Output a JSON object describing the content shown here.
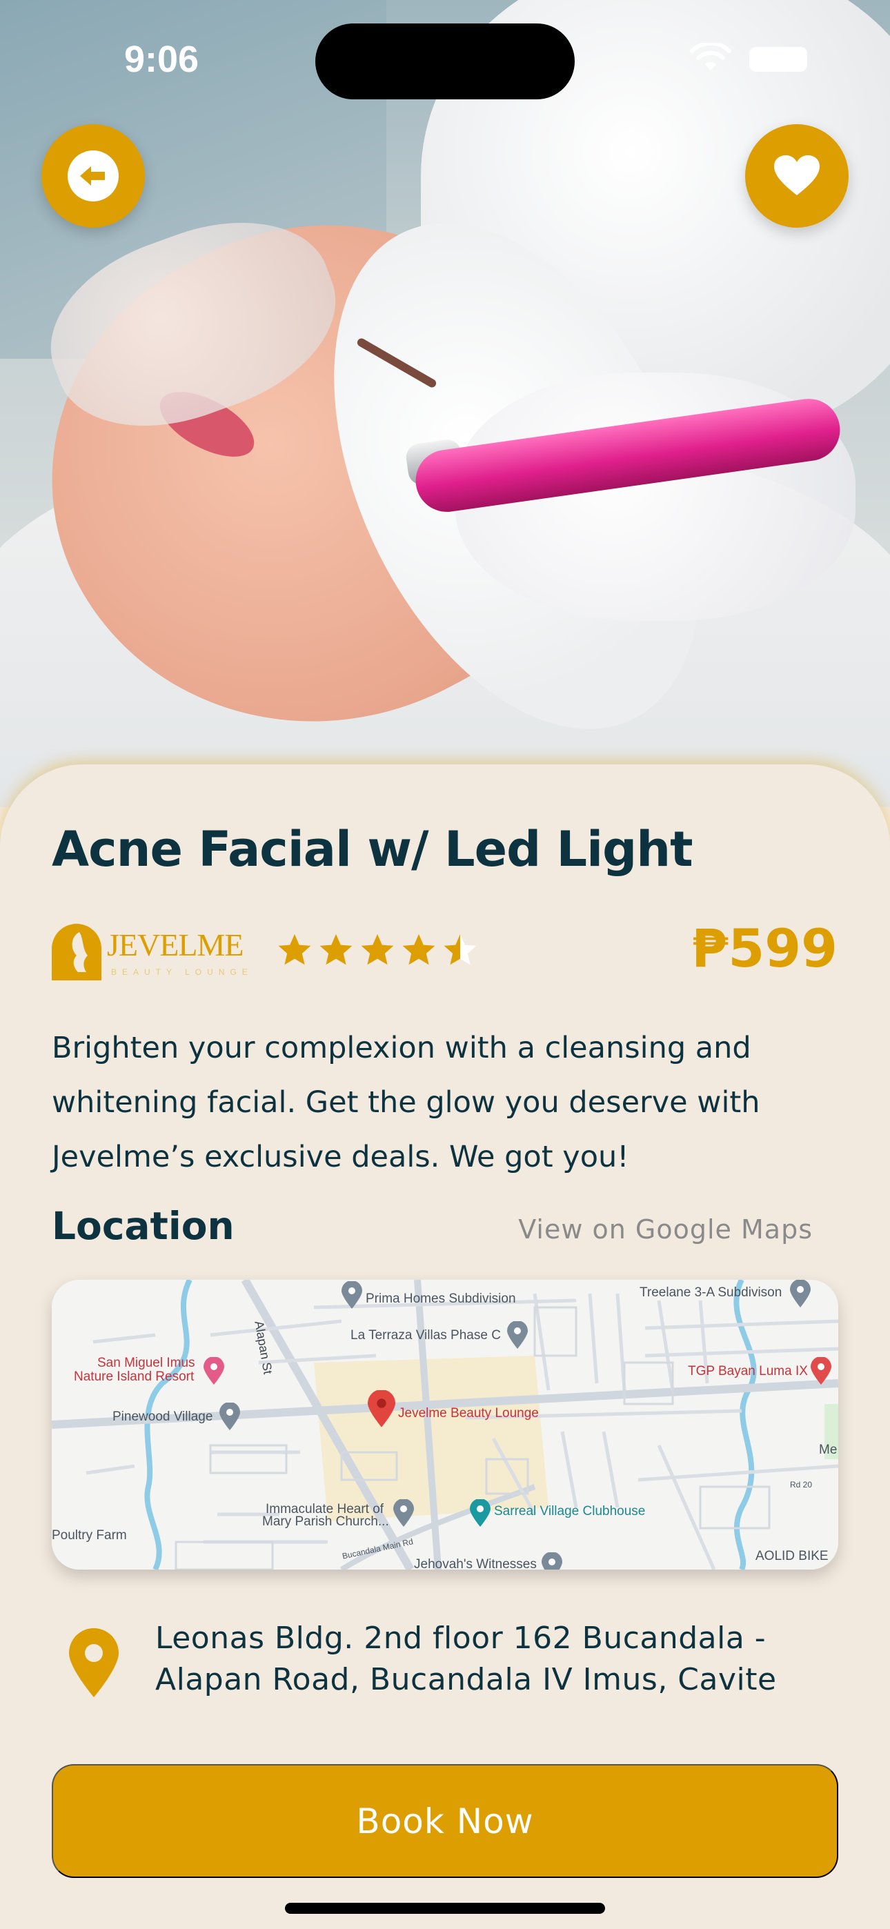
{
  "status_bar": {
    "time": "9:06"
  },
  "service": {
    "title": "Acne Facial w/ Led Light",
    "price": "₱599",
    "rating": 4.5,
    "rating_max": 5,
    "description": "Brighten your complexion with a cleansing and whitening facial. Get the glow you deserve with Jevelme’s exclusive deals. We got you!"
  },
  "brand": {
    "logo_text": "JEVELME",
    "logo_subtext": "BEAUTY LOUNGE"
  },
  "location": {
    "heading": "Location",
    "maps_link": "View on Google Maps",
    "address": "Leonas Bldg. 2nd floor 162 Bucandala - Alapan Road, Bucandala IV Imus, Cavite",
    "map_labels": {
      "prima": "Prima Homes Subdivision",
      "treelane": "Treelane 3-A Subdivison",
      "terraza": "La Terraza Villas Phase C",
      "san_miguel_1": "San Miguel Imus",
      "san_miguel_2": "Nature Island Resort",
      "tgp": "TGP Bayan Luma IX",
      "pinewood": "Pinewood Village",
      "jevelme": "Jevelme Beauty Lounge",
      "alapan": "Alapan St",
      "me": "Me",
      "immaculate_1": "Immaculate Heart of",
      "immaculate_2": "Mary Parish Church...",
      "sarreal": "Sarreal Village Clubhouse",
      "poultry": "Poultry Farm",
      "aolid": "AOLID BIKE",
      "jehovah": "Jehovah's Witnesses",
      "rd20": "Rd 20",
      "main_rd": "Bucandala Main Rd"
    }
  },
  "actions": {
    "book_label": "Book Now"
  },
  "colors": {
    "accent": "#dc9e00",
    "text": "#0d3340",
    "background": "#f3eadf"
  }
}
